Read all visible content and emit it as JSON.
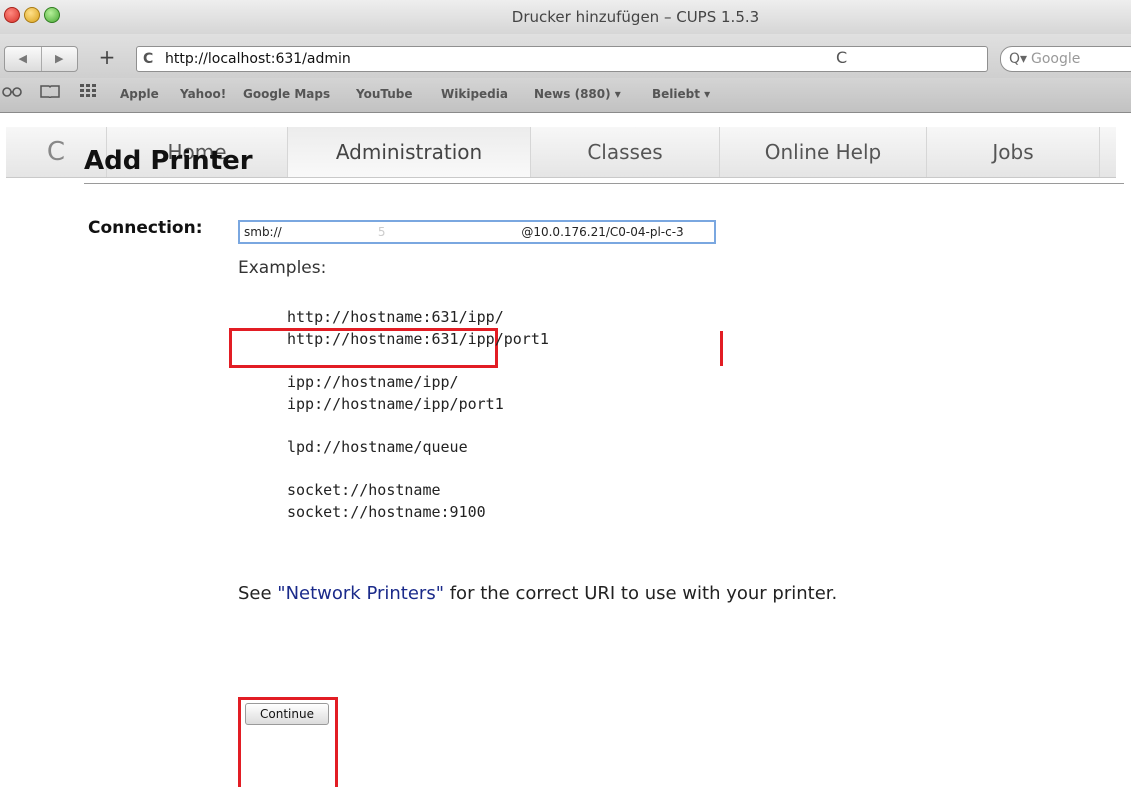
{
  "window": {
    "title": "Drucker hinzufügen – CUPS 1.5.3"
  },
  "toolbar": {
    "back": "◀",
    "forward": "▶",
    "new_tab": "+",
    "url": "http://localhost:631/admin",
    "reload": "C",
    "search_icon": "Q▾",
    "search_placeholder": "Google"
  },
  "bookmarks": {
    "icons": [
      "reading-list-icon",
      "bookmarks-book-icon",
      "top-sites-grid-icon"
    ],
    "items": [
      "Apple",
      "Yahoo!",
      "Google Maps",
      "YouTube",
      "Wikipedia",
      "News (880) ▾",
      "Beliebt ▾"
    ]
  },
  "cups_nav": {
    "logo": "C",
    "tabs": [
      "Home",
      "Administration",
      "Classes",
      "Online Help",
      "Jobs"
    ],
    "active": "Administration"
  },
  "page": {
    "heading": "Add Printer",
    "connection_label": "Connection:",
    "connection_prefix": "smb://",
    "connection_mid": "5",
    "connection_suffix": "@10.0.176.21/C0-04-pl-c-3",
    "examples_label": "Examples:",
    "examples": [
      [
        "http://hostname:631/ipp/",
        "http://hostname:631/ipp/port1"
      ],
      [
        "ipp://hostname/ipp/",
        "ipp://hostname/ipp/port1"
      ],
      [
        "lpd://hostname/queue"
      ],
      [
        "socket://hostname",
        "socket://hostname:9100"
      ]
    ],
    "note_before": "See ",
    "note_link": "\"Network Printers\"",
    "note_after": " for the correct URI to use with your printer.",
    "continue_label": "Continue"
  },
  "colors": {
    "highlight": "#e21d24",
    "link": "#1a2a8a",
    "input_focus": "#7aa7e0"
  }
}
